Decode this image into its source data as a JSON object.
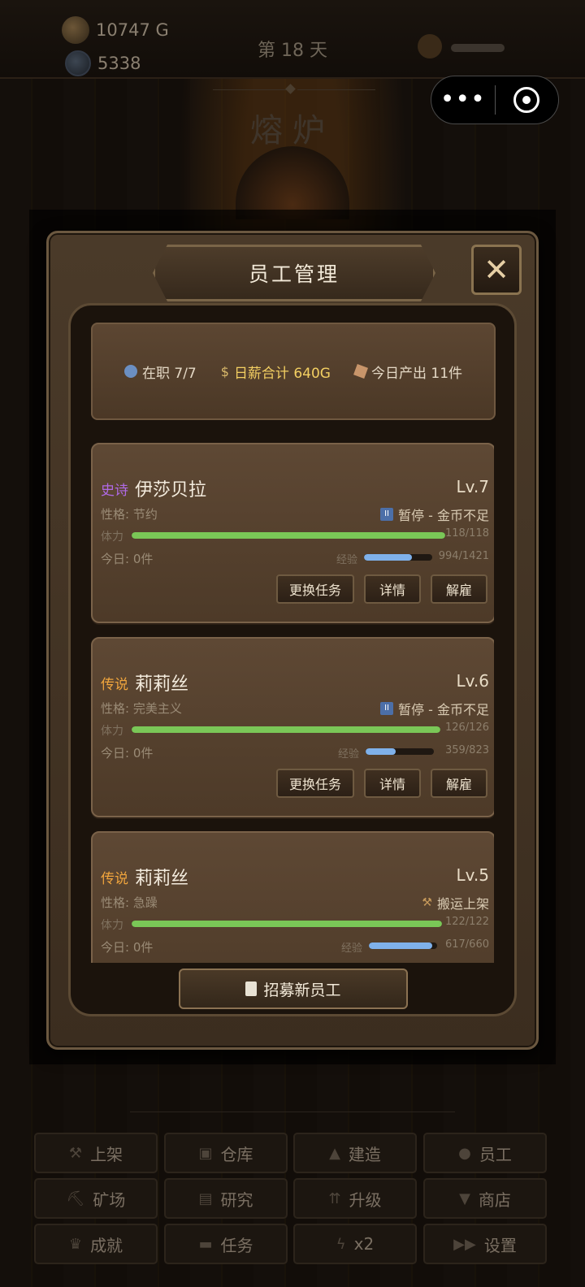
{
  "top": {
    "gold": "10747 G",
    "gems": "5338",
    "day": "第 18 天"
  },
  "capsule": {
    "more": "•••"
  },
  "scene": {
    "title": "熔炉"
  },
  "modal": {
    "title": "员工管理",
    "close": "✕",
    "summary": {
      "staff": "在职 7/7",
      "wage": "日薪合计 640G",
      "output": "今日产出 11件"
    },
    "recruit": "招募新员工"
  },
  "employees": [
    {
      "rarity": "史诗",
      "name": "伊莎贝拉",
      "level": "Lv.7",
      "trait": "性格: 节约",
      "status": "暂停 - 金币不足",
      "hp_label": "体力",
      "hp_text": "118/118",
      "hp_frac": 1.0,
      "today": "今日: 0件",
      "xp_label": "经验",
      "xp_text": "994/1421",
      "xp_frac": 0.7,
      "btn_change": "更换任务",
      "btn_detail": "详情",
      "btn_fire": "解雇"
    },
    {
      "rarity": "传说",
      "name": "莉莉丝",
      "level": "Lv.6",
      "trait": "性格: 完美主义",
      "status": "暂停 - 金币不足",
      "hp_label": "体力",
      "hp_text": "126/126",
      "hp_frac": 1.0,
      "today": "今日: 0件",
      "xp_label": "经验",
      "xp_text": "359/823",
      "xp_frac": 0.44,
      "btn_change": "更换任务",
      "btn_detail": "详情",
      "btn_fire": "解雇"
    },
    {
      "rarity": "传说",
      "name": "莉莉丝",
      "level": "Lv.5",
      "trait": "性格: 急躁",
      "status": "搬运上架",
      "hp_label": "体力",
      "hp_text": "122/122",
      "hp_frac": 1.0,
      "today": "今日: 0件",
      "xp_label": "经验",
      "xp_text": "617/660",
      "xp_frac": 0.93
    }
  ],
  "nav": [
    {
      "icon": "hammer-icon",
      "label": "上架"
    },
    {
      "icon": "box-icon",
      "label": "仓库"
    },
    {
      "icon": "building-icon",
      "label": "建造"
    },
    {
      "icon": "person-icon",
      "label": "员工"
    },
    {
      "icon": "pickaxe-icon",
      "label": "矿场"
    },
    {
      "icon": "book-icon",
      "label": "研究"
    },
    {
      "icon": "upgrade-icon",
      "label": "升级"
    },
    {
      "icon": "cart-icon",
      "label": "商店"
    },
    {
      "icon": "trophy-icon",
      "label": "成就"
    },
    {
      "icon": "anvil-icon",
      "label": "任务"
    },
    {
      "icon": "lightning-icon",
      "label": "x2"
    },
    {
      "icon": "fast-forward-icon",
      "label": "设置"
    }
  ]
}
